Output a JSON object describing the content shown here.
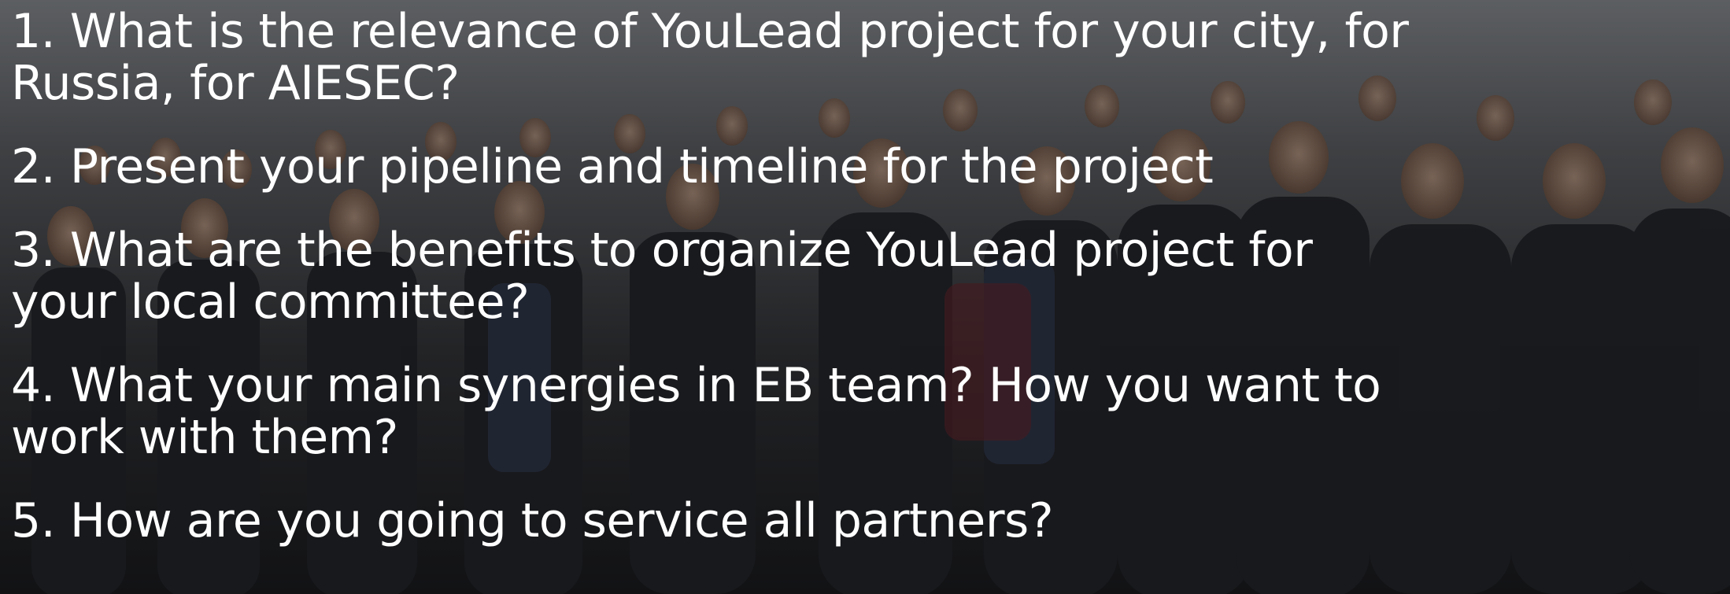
{
  "slide": {
    "background": {
      "description_icon": "audience-photo",
      "overlay_color": "#000000"
    },
    "text_color": "#ffffff",
    "questions": [
      "1. What is the relevance of YouLead project for your city, for\nRussia, for AIESEC?",
      "2. Present your pipeline and timeline for the project",
      "3. What are the benefits to organize YouLead project for\nyour local committee?",
      "4. What your main synergies in EB team? How you want to\nwork with them?",
      "5. How are you going to service all partners?"
    ]
  }
}
